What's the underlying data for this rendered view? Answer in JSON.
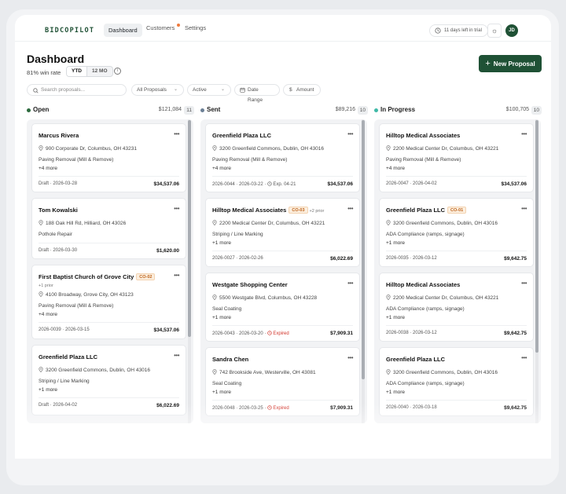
{
  "app": {
    "logo": "BIDCOPILOT",
    "nav": [
      {
        "label": "Dashboard",
        "active": true
      },
      {
        "label": "Customers",
        "active": false,
        "dot": true
      },
      {
        "label": "Settings",
        "active": false
      }
    ],
    "trial": "11 days left in trial",
    "avatar": "JD"
  },
  "page": {
    "title": "Dashboard",
    "win_rate": "81% win rate",
    "period_options": [
      "YTD",
      "12 MO"
    ],
    "period_selected": "YTD",
    "new_button": "New Proposal"
  },
  "filters": {
    "search_placeholder": "Search proposals...",
    "proposal_type": "All Proposals",
    "status": "Active",
    "date_range": "Date Range",
    "amount": "Amount"
  },
  "colors": {
    "brand": "#1f5135",
    "open": "#2d6a3e",
    "sent": "#6b7f95",
    "in_progress": "#3fb9a7",
    "expired": "#d2352b",
    "badge": "#c0651d"
  },
  "columns": [
    {
      "name": "Open",
      "total": "$121,084",
      "count": "11",
      "cards": [
        {
          "title": "Marcus Rivera",
          "address": "900 Corporate Dr, Columbus, OH 43231",
          "service": "Paving Removal (Mill & Remove)",
          "more": "+4 more",
          "meta": "Draft · 2026-03-28",
          "amount": "$34,537.06"
        },
        {
          "title": "Tom Kowalski",
          "address": "188 Oak Hill Rd, Hilliard, OH 43026",
          "service": "Pothole Repair",
          "meta": "Draft · 2026-03-30",
          "amount": "$1,620.00"
        },
        {
          "title": "First Baptist Church of Grove City",
          "badge": "CO-02",
          "prior_line": "+1 prior",
          "address": "4100 Broadway, Grove City, OH 43123",
          "service": "Paving Removal (Mill & Remove)",
          "more": "+4 more",
          "meta": "2026-0039 · 2026-03-15",
          "amount": "$34,537.06"
        },
        {
          "title": "Greenfield Plaza LLC",
          "address": "3200 Greenfield Commons, Dublin, OH 43016",
          "service": "Striping / Line Marking",
          "more": "+1 more",
          "meta": "Draft · 2026-04-02",
          "amount": "$6,022.69"
        }
      ]
    },
    {
      "name": "Sent",
      "total": "$89,216",
      "count": "10",
      "cards": [
        {
          "title": "Greenfield Plaza LLC",
          "address": "3200 Greenfield Commons, Dublin, OH 43016",
          "service": "Paving Removal (Mill & Remove)",
          "more": "+4 more",
          "meta": "2026-0044 · 2026-03-22 ·",
          "exp": "Exp. 04-21",
          "amount": "$34,537.06"
        },
        {
          "title": "Hilltop Medical Associates",
          "badge": "CO-03",
          "prior": "+2 prior",
          "address": "2200 Medical Center Dr, Columbus, OH 43221",
          "service": "Striping / Line Marking",
          "more": "+1 more",
          "meta": "2026-0027 · 2026-02-26",
          "amount": "$6,022.69"
        },
        {
          "title": "Westgate Shopping Center",
          "address": "5500 Westgate Blvd, Columbus, OH 43228",
          "service": "Seal Coating",
          "more": "+1 more",
          "meta": "2026-0043 · 2026-03-20 ·",
          "expired": "Expired",
          "amount": "$7,909.31"
        },
        {
          "title": "Sandra Chen",
          "address": "742 Brookside Ave, Westerville, OH 43081",
          "service": "Seal Coating",
          "more": "+1 more",
          "meta": "2026-0048 · 2026-03-25 ·",
          "expired": "Expired",
          "amount": "$7,909.31"
        }
      ]
    },
    {
      "name": "In Progress",
      "total": "$100,705",
      "count": "10",
      "cards": [
        {
          "title": "Hilltop Medical Associates",
          "address": "2200 Medical Center Dr, Columbus, OH 43221",
          "service": "Paving Removal (Mill & Remove)",
          "more": "+4 more",
          "meta": "2026-0047 · 2026-04-02",
          "amount": "$34,537.06"
        },
        {
          "title": "Greenfield Plaza LLC",
          "badge": "CO-01",
          "address": "3200 Greenfield Commons, Dublin, OH 43016",
          "service": "ADA Compliance (ramps, signage)",
          "more": "+1 more",
          "meta": "2026-0035 · 2026-03-12",
          "amount": "$9,642.75"
        },
        {
          "title": "Hilltop Medical Associates",
          "address": "2200 Medical Center Dr, Columbus, OH 43221",
          "service": "ADA Compliance (ramps, signage)",
          "more": "+1 more",
          "meta": "2026-0038 · 2026-03-12",
          "amount": "$9,642.75"
        },
        {
          "title": "Greenfield Plaza LLC",
          "address": "3200 Greenfield Commons, Dublin, OH 43016",
          "service": "ADA Compliance (ramps, signage)",
          "more": "+1 more",
          "meta": "2026-0040 · 2026-03-18",
          "amount": "$9,642.75"
        }
      ]
    }
  ]
}
